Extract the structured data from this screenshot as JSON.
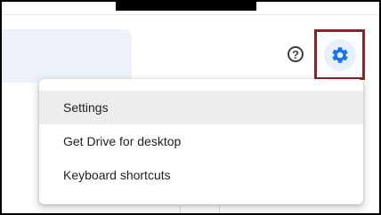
{
  "header": {
    "search_dropdown_icon": "caret-down-icon",
    "help_icon": "question-mark-circle-icon",
    "settings_icon": "gear-icon",
    "accent_color": "#1a73e8",
    "highlight_color": "#9b1c1c"
  },
  "settings_menu": {
    "items": [
      {
        "label": "Settings",
        "active": true
      },
      {
        "label": "Get Drive for desktop",
        "active": false
      },
      {
        "label": "Keyboard shortcuts",
        "active": false
      }
    ]
  }
}
